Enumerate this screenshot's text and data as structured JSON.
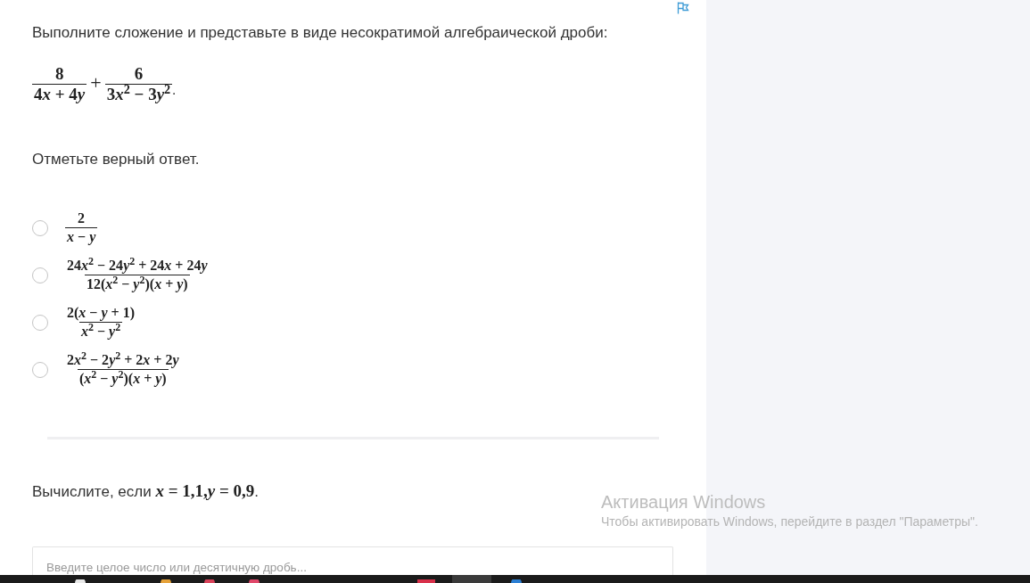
{
  "task_1": {
    "instruction": "Выполните сложение и представьте в виде несократимой алгебраической дроби:",
    "expression": [
      {
        "kind": "fraction",
        "numerator": "8",
        "denominator": "4x + 4y"
      },
      {
        "kind": "operator",
        "text": "+"
      },
      {
        "kind": "fraction",
        "numerator": "6",
        "denominator": "3x$^{2}$ − 3y$^{2}$"
      },
      {
        "kind": "punct",
        "text": "."
      }
    ],
    "prompt": "Отметьте верный ответ.",
    "options": [
      {
        "numerator": "2",
        "denominator": "x − y",
        "selected": false
      },
      {
        "numerator": "24x$^{2}$ − 24y$^{2}$ + 24x + 24y",
        "denominator": "12(x$^{2}$ − y$^{2}$)(x + y)",
        "selected": false
      },
      {
        "numerator": "2(x − y + 1)",
        "denominator": "x$^{2}$ − y$^{2}$",
        "selected": false
      },
      {
        "numerator": "2x$^{2}$ − 2y$^{2}$ + 2x + 2y",
        "denominator": "(x$^{2}$ − y$^{2}$)(x + y)",
        "selected": false
      }
    ]
  },
  "task_2": {
    "prompt": "Вычислите, если",
    "condition": "x = 1,1,y = 0,9",
    "end": ".",
    "answer_field": {
      "placeholder": "Введите целое число или десятичную дробь..."
    }
  },
  "os_notice": {
    "title": "Активация Windows",
    "text": "Чтобы активировать Windows, перейдите в раздел \"Параметры\"."
  }
}
